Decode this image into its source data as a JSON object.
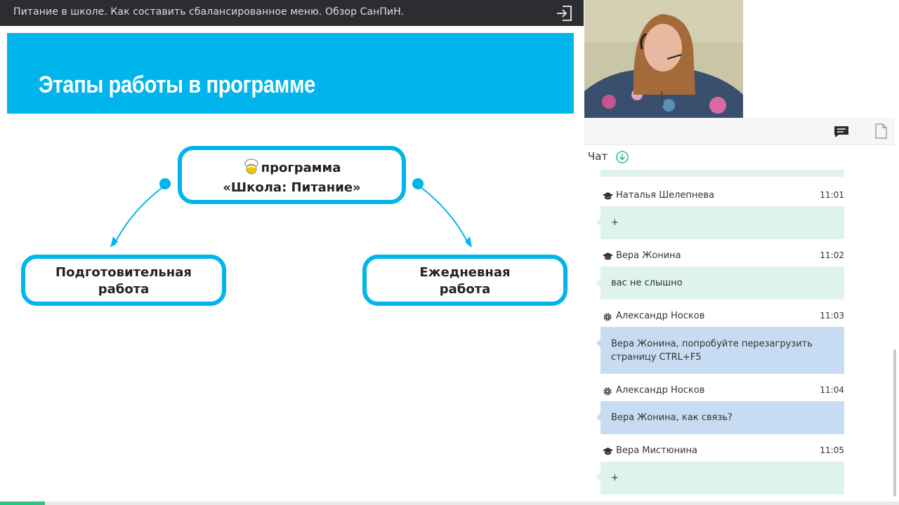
{
  "window": {
    "title": "Питание в школе. Как составить сбалансированное меню. Обзор СанПиН."
  },
  "slide": {
    "heading": "Этапы работы в программе",
    "main_node": {
      "line1": "программа",
      "line2": "«Школа: Питание»"
    },
    "left_node": {
      "line1": "Подготовительная",
      "line2": "работа"
    },
    "right_node": {
      "line1": "Ежедневная",
      "line2": "работа"
    }
  },
  "colors": {
    "accent": "#00b4ec",
    "dark_bar": "#2c2d31",
    "bubble_user": "#def3ea",
    "bubble_moderator": "#c7dcf2",
    "progress": "#2fc47c"
  },
  "panel": {
    "tabs": [
      {
        "icon": "chat-icon",
        "active": true
      },
      {
        "icon": "file-icon",
        "active": false
      }
    ],
    "chat_title": "Чат"
  },
  "chat": {
    "messages": [
      {
        "author": "Наталья Шелепнева",
        "role": "student",
        "role_icon": "graduation-cap-icon",
        "time": "11:01",
        "text": "+"
      },
      {
        "author": "Вера Жонина",
        "role": "student",
        "role_icon": "graduation-cap-icon",
        "time": "11:02",
        "text": "вас не слышно"
      },
      {
        "author": "Александр Носков",
        "role": "moderator",
        "role_icon": "gear-icon",
        "time": "11:03",
        "text": "Вера Жонина, попробуйте перезагрузить страницу CTRL+F5"
      },
      {
        "author": "Александр Носков",
        "role": "moderator",
        "role_icon": "gear-icon",
        "time": "11:04",
        "text": "Вера Жонина, как связь?"
      },
      {
        "author": "Вера Мистюнина",
        "role": "student",
        "role_icon": "graduation-cap-icon",
        "time": "11:05",
        "text": "+"
      }
    ]
  },
  "progress": {
    "fraction": 0.05
  }
}
